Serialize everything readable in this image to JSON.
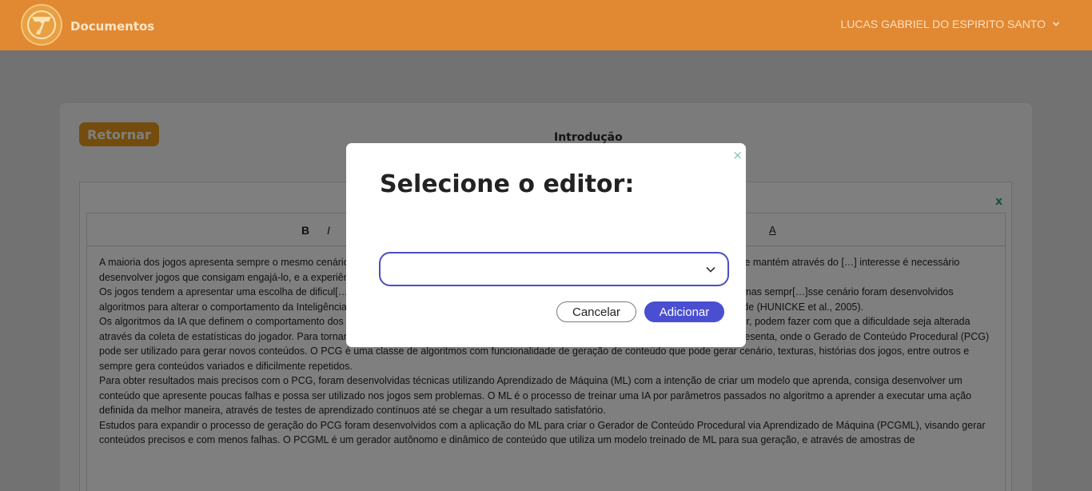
{
  "header": {
    "app_title": "Documentos",
    "user_name": "LUCAS GABRIEL DO ESPIRITO SANTO",
    "logo_icon": "logo-icon",
    "user_menu_icon": "chevron-down-icon"
  },
  "page": {
    "back_label": "Retornar",
    "section_title": "Introdução",
    "editor_close": "x"
  },
  "toolbar": {
    "bold": "B",
    "italic": "I",
    "font_color": "A"
  },
  "editor": {
    "paragraphs": [
      "A maioria dos jogos apresenta sempre o mesmo cenário, […] tempo jogando. A indústria de jogos digitais atua no ambiente do entretenimento e se mantém através do […] interesse é necessário desenvolver jogos que consigam engajá-lo, e a experiência precisa ser satisf[…]",
      "Os jogos tendem a apresentar uma escolha de dificul[…]rios nas fases do jogo, ou é fortalecido algum atributo que torna o adversário mais forte, mas sempr[…]sse cenário foram desenvolvidos algoritmos para alterar o comportamento da Inteligência Artificial (IA) […] chamado Hamlet que possui algoritmos de Ajuste Dinâmico de Dificuldade (HUNICKE et al., 2005).",
      "Os algoritmos da IA que definem o comportamento dos personagens não jogáveis, como a percepção que utiliza para encontrar e atacar o jogador, podem fazer com que a dificuldade seja alterada através da coleta de estatísticas do jogador. Para tornar melhor essa experiência é preciso gerar elementos diversificados além do que o jogo apresenta, onde o Gerado de Conteúdo Procedural (PCG) pode ser utilizado para gerar novos conteúdos. O PCG é uma classe de algoritmos com funcionalidade de geração de conteúdo que pode gerar cenário, texturas, histórias dos jogos, entre outros e sempre gera conteúdos variados e dificilmente repetidos.",
      "Para obter resultados mais precisos com o PCG, foram desenvolvidas técnicas utilizando Aprendizado de Máquina (ML) com a intenção de criar um modelo que aprenda, consiga desenvolver um conteúdo que apresente poucas falhas e possa ser utilizado nos jogos sem problemas. O ML é o processo de treinar uma IA por parâmetros passados no algoritmo a aprender a executar uma ação definida da melhor maneira, através de testes de aprendizado contínuos até se chegar a um resultado satisfatório.",
      "Estudos para expandir o processo de geração do PCG foram desenvolvidos com a aplicação do ML para criar o Gerador de Conteúdo Procedural via Aprendizado de Máquina (PCGML), visando gerar conteúdos precisos e com menos falhas. O PCGML é um gerador autônomo e dinâmico de conteúdo que utiliza um modelo treinado de ML para sua geração, e através de amostras de"
    ]
  },
  "modal": {
    "title": "Selecione o editor:",
    "close": "×",
    "select_value": "",
    "cancel_label": "Cancelar",
    "add_label": "Adicionar"
  },
  "colors": {
    "header": "#e18833",
    "back_button": "#e89b1d",
    "primary_button": "#4a4fd1",
    "select_border": "#4a4ec4"
  }
}
